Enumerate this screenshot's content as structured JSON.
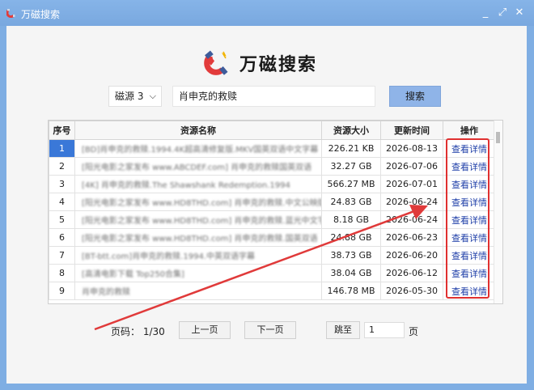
{
  "window": {
    "title": "万磁搜索",
    "controls": [
      "_",
      "⤢",
      "✕"
    ]
  },
  "brand": {
    "name": "万磁搜索"
  },
  "search": {
    "source_selected": "磁源 3",
    "query": "肖申克的救赎",
    "button_label": "搜索"
  },
  "table": {
    "headers": [
      "序号",
      "资源名称",
      "资源大小",
      "更新时间",
      "操作"
    ],
    "rows": [
      {
        "index": "1",
        "name": "[BD]肖申克的救赎.1994.4K超高清修复版.MKV国英双语中文字幕",
        "size": "226.21 KB",
        "date": "2026-08-13",
        "action": "查看详情"
      },
      {
        "index": "2",
        "name": "[阳光电影之家发布 www.ABCDEF.com] 肖申克的救赎国英双语",
        "size": "32.27 GB",
        "date": "2026-07-06",
        "action": "查看详情"
      },
      {
        "index": "3",
        "name": "[4K] 肖申克的救赎.The Shawshank Redemption.1994",
        "size": "566.27 MB",
        "date": "2026-07-01",
        "action": "查看详情"
      },
      {
        "index": "4",
        "name": "[阳光电影之家发布 www.HD8THD.com] 肖申克的救赎.中文公映版",
        "size": "24.83 GB",
        "date": "2026-06-24",
        "action": "查看详情"
      },
      {
        "index": "5",
        "name": "[阳光电影之家发布 www.HD8THD.com] 肖申克的救赎.蓝光中文字幕",
        "size": "8.18 GB",
        "date": "2026-06-24",
        "action": "查看详情"
      },
      {
        "index": "6",
        "name": "[阳光电影之家发布 www.HD8THD.com] 肖申克的救赎.国英双语",
        "size": "24.88 GB",
        "date": "2026-06-23",
        "action": "查看详情"
      },
      {
        "index": "7",
        "name": "[BT-btt.com]肖申克的救赎.1994.中英双语字幕",
        "size": "38.73 GB",
        "date": "2026-06-20",
        "action": "查看详情"
      },
      {
        "index": "8",
        "name": "[高清电影下载 Top250合集]",
        "size": "38.04 GB",
        "date": "2026-06-12",
        "action": "查看详情"
      },
      {
        "index": "9",
        "name": "肖申克的救赎",
        "size": "146.78 MB",
        "date": "2026-05-30",
        "action": "查看详情"
      }
    ]
  },
  "pager": {
    "label": "页码：",
    "current": "1/30",
    "prev_label": "上一页",
    "next_label": "下一页",
    "jump_label": "跳至",
    "jump_value": "1",
    "unit": "页"
  },
  "colors": {
    "titlebar": "#7faee3",
    "accent_button": "#8fb4e8",
    "highlight": "#e03030",
    "selected_row": "#3a78d8",
    "link": "#1f3fa8"
  }
}
